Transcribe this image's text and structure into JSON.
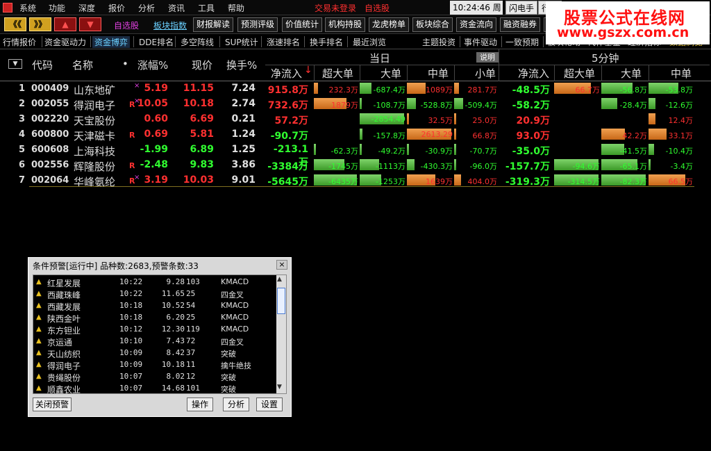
{
  "menu": {
    "items": [
      "系统",
      "功能",
      "深度",
      "报价",
      "分析",
      "资讯",
      "工具",
      "帮助"
    ],
    "login_status": "交易未登录",
    "select_stock": "自选股",
    "clock": "10:24:46 周一",
    "flash_btn": "闪电手",
    "quote_btn": "行情"
  },
  "watermark": {
    "title": "股票公式在线网",
    "url": "www.gszx.com.cn"
  },
  "toolbar": {
    "nav_left": "《《",
    "nav_right": "》》",
    "nav_up": "▲",
    "nav_down": "▼",
    "links": [
      "自选股",
      "板块指数"
    ],
    "buttons": [
      "财报解读",
      "预测评级",
      "价值统计",
      "机构持股",
      "龙虎榜单",
      "板块综合",
      "资金流向",
      "融资融券",
      "找"
    ]
  },
  "tabs": {
    "items": [
      "行情报价",
      "资金驱动力",
      "资金博弈",
      "DDE排名",
      "多空阵线",
      "SUP统计",
      "涨速排名",
      "换手排名",
      "最近浏览",
      "主题投资",
      "事件驱动",
      "一致预期",
      "板块轮动",
      "代作基金",
      "经济指标",
      "数据浏览"
    ],
    "active": "资金博弈"
  },
  "header": {
    "code": "代码",
    "name": "名称",
    "dot": "•",
    "change": "涨幅%",
    "price": "现价",
    "turnover": "换手%",
    "period_today": "当日",
    "period_5min": "5分钟",
    "explain": "说明",
    "today_cols": [
      "净流入",
      "超大单",
      "大单",
      "中单",
      "小单"
    ],
    "min5_cols": [
      "净流入",
      "超大单",
      "大单",
      "中单"
    ],
    "sort_arrow": "↓",
    "select_icon": "▼"
  },
  "colors": {
    "up": "#ff3030",
    "down": "#30ff30",
    "bar_green": "#3c9a28",
    "bar_orange": "#e08030"
  },
  "rows": [
    {
      "idx": "1",
      "code": "000409",
      "name": "山东地矿",
      "flag": "",
      "flag_x": "×",
      "change": "5.19",
      "price": "11.15",
      "turnover": "7.24",
      "net": "915.8万",
      "today": [
        "232.3万",
        "-687.4万",
        "1089万",
        "281.7万"
      ],
      "net5": "-48.5万",
      "min5": [
        "66.7万",
        "-56.8万",
        "-53.8万"
      ]
    },
    {
      "idx": "2",
      "code": "002055",
      "name": "得润电子",
      "flag": "R",
      "flag_x": "×",
      "change": "10.05",
      "price": "10.18",
      "turnover": "2.74",
      "net": "732.6万",
      "today": [
        "1879万",
        "-108.7万",
        "-528.8万",
        "-509.4万"
      ],
      "net5": "-58.2万",
      "min5": [
        "",
        "-28.4万",
        "-12.6万"
      ]
    },
    {
      "idx": "3",
      "code": "002220",
      "name": "天宝股份",
      "flag": "",
      "flag_x": "",
      "change": "0.60",
      "price": "6.69",
      "turnover": "0.21",
      "net": "57.2万",
      "today": [
        "",
        "-2854.49",
        "32.5万",
        "25.0万"
      ],
      "net5": "20.9万",
      "min5": [
        "",
        "",
        "12.4万"
      ]
    },
    {
      "idx": "4",
      "code": "600800",
      "name": "天津磁卡",
      "flag": "R",
      "flag_x": "",
      "change": "0.69",
      "price": "5.81",
      "turnover": "1.24",
      "net": "-90.7万",
      "today": [
        "",
        "-157.8万",
        "2613.29",
        "66.8万"
      ],
      "net5": "93.0万",
      "min5": [
        "",
        "42.2万",
        "33.1万"
      ]
    },
    {
      "idx": "5",
      "code": "600608",
      "name": "上海科技",
      "flag": "",
      "flag_x": "",
      "change": "-1.99",
      "price": "6.89",
      "turnover": "1.25",
      "net": "-213.1万",
      "today": [
        "-62.3万",
        "-49.2万",
        "-30.9万",
        "-70.7万"
      ],
      "net5": "-35.0万",
      "min5": [
        "",
        "-41.5万",
        "-10.4万"
      ]
    },
    {
      "idx": "6",
      "code": "002556",
      "name": "辉隆股份",
      "flag": "R",
      "flag_x": "",
      "change": "-2.48",
      "price": "9.83",
      "turnover": "3.86",
      "net": "-3384万",
      "today": [
        "-1745万",
        "-1113万",
        "-430.3万",
        "-96.0万"
      ],
      "net5": "-157.7万",
      "min5": [
        "-94.6万",
        "-65.1万",
        "-3.4万"
      ]
    },
    {
      "idx": "7",
      "code": "002064",
      "name": "华峰氨纶",
      "flag": "R",
      "flag_x": "×",
      "change": "3.19",
      "price": "10.03",
      "turnover": "9.01",
      "net": "-5645万",
      "today": [
        "-6435万",
        "-1253万",
        "1639万",
        "404.0万"
      ],
      "net5": "-319.3万",
      "min5": [
        "-314.5万",
        "-82.3万",
        "66.5万"
      ]
    }
  ],
  "alert": {
    "title": "条件预警[运行中] 品种数:2683,预警条数:33",
    "close": "×",
    "rows": [
      {
        "name": "红星发展",
        "time": "10:22",
        "price": "9.28",
        "count": "103",
        "cond": "KMACD"
      },
      {
        "name": "西藏珠峰",
        "time": "10:22",
        "price": "11.65",
        "count": "25",
        "cond": "四金叉"
      },
      {
        "name": "西藏发展",
        "time": "10:18",
        "price": "10.52",
        "count": "54",
        "cond": "KMACD"
      },
      {
        "name": "陕西金叶",
        "time": "10:18",
        "price": "6.20",
        "count": "25",
        "cond": "KMACD"
      },
      {
        "name": "东方钽业",
        "time": "10:12",
        "price": "12.30",
        "count": "119",
        "cond": "KMACD"
      },
      {
        "name": "京运通",
        "time": "10:10",
        "price": "7.43",
        "count": "72",
        "cond": "四金叉"
      },
      {
        "name": "天山纺织",
        "time": "10:09",
        "price": "8.42",
        "count": "37",
        "cond": "突破"
      },
      {
        "name": "得润电子",
        "time": "10:09",
        "price": "10.18",
        "count": "11",
        "cond": "擒牛绝技"
      },
      {
        "name": "贵绳股份",
        "time": "10:07",
        "price": "8.02",
        "count": "12",
        "cond": "突破"
      },
      {
        "name": "顺鑫农业",
        "time": "10:07",
        "price": "14.68",
        "count": "101",
        "cond": "突破"
      }
    ],
    "buttons": {
      "close_alert": "关闭预警",
      "operate": "操作",
      "analyze": "分析",
      "settings": "设置"
    }
  }
}
